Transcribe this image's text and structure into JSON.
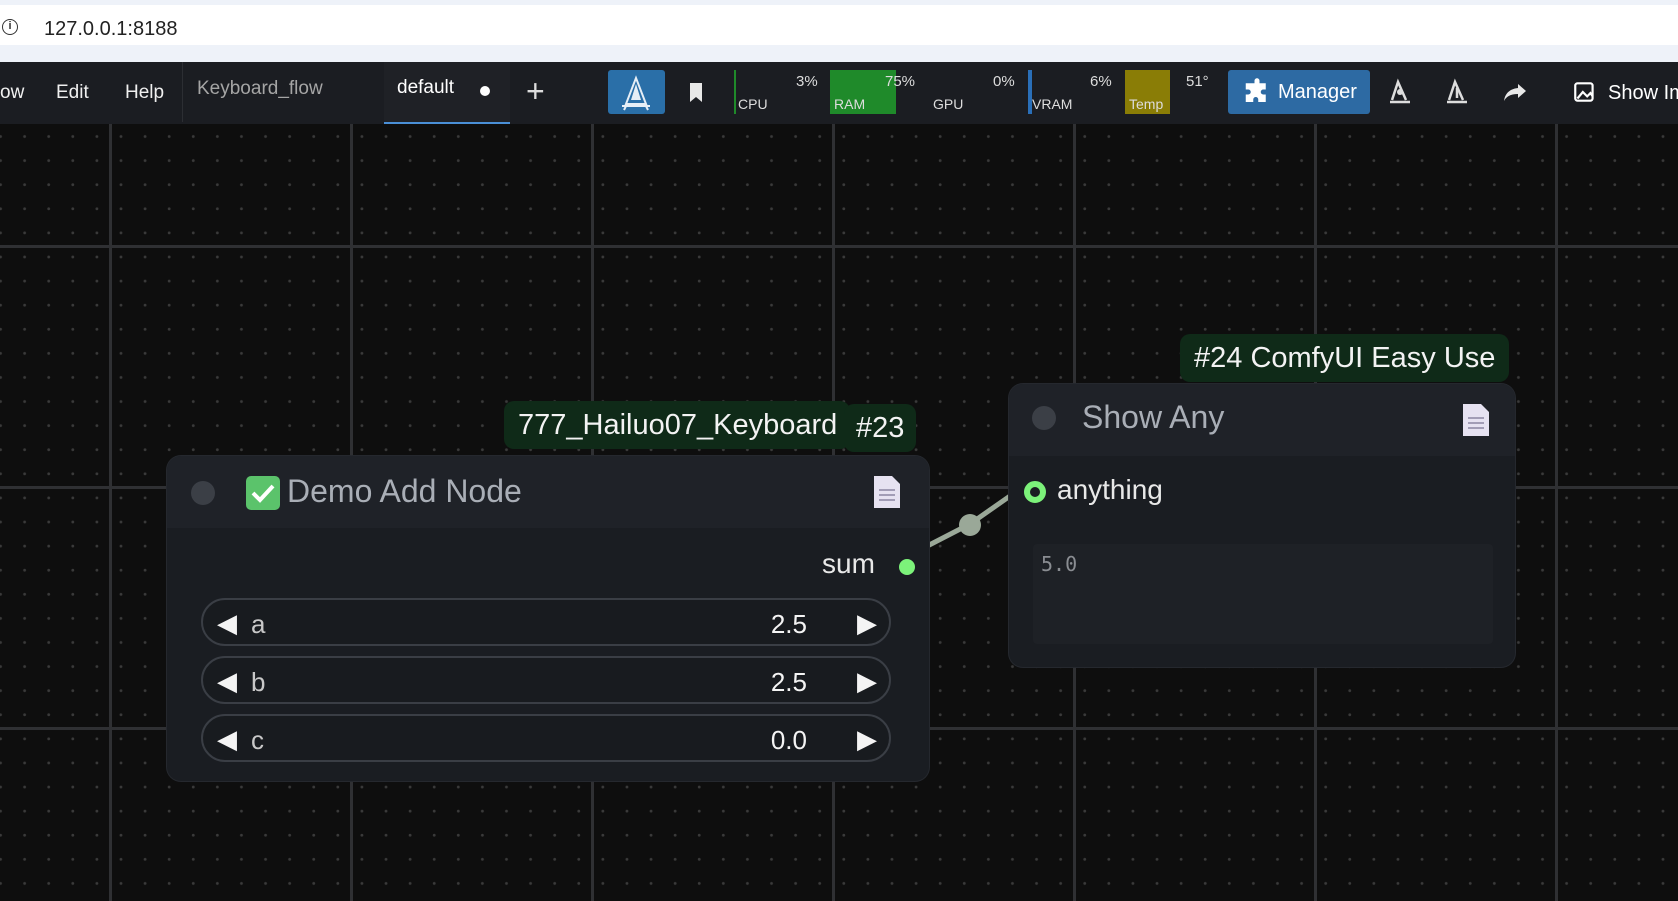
{
  "browser": {
    "url": "127.0.0.1:8188"
  },
  "menu": {
    "items": [
      "ow",
      "Edit",
      "Help"
    ],
    "tabs": [
      {
        "label": "Keyboard_flow",
        "active": false
      },
      {
        "label": "default",
        "active": true,
        "modified": true
      }
    ],
    "add_tab_symbol": "+"
  },
  "monitors": {
    "cpu": {
      "name": "CPU",
      "pct": "3%",
      "color": "#1f8a2a"
    },
    "ram": {
      "name": "RAM",
      "pct": "75%",
      "color": "#1f8a2a"
    },
    "gpu": {
      "name": "GPU",
      "pct": "0%",
      "color": "#1f8a2a"
    },
    "vram": {
      "name": "VRAM",
      "pct": "6%",
      "color": "#2a6fb8"
    },
    "temp": {
      "name": "Temp",
      "pct": "51°",
      "color": "#8a7d06"
    }
  },
  "toolbar": {
    "manager_label": "Manager",
    "show_label": "Show Im",
    "accent": "#2d6aa3"
  },
  "nodes": {
    "demo": {
      "group_badge": "777_Hailuo07_Keyboard",
      "id_badge": "#23",
      "title": "Demo Add Node",
      "output": "sum",
      "widgets": [
        {
          "name": "a",
          "value": "2.5"
        },
        {
          "name": "b",
          "value": "2.5"
        },
        {
          "name": "c",
          "value": "0.0"
        }
      ]
    },
    "show_any": {
      "badge": "#24 ComfyUI Easy Use",
      "title": "Show Any",
      "input": "anything",
      "output_text": "5.0"
    }
  },
  "colors": {
    "slot": "#7cf27a",
    "link": "#9aa898"
  }
}
